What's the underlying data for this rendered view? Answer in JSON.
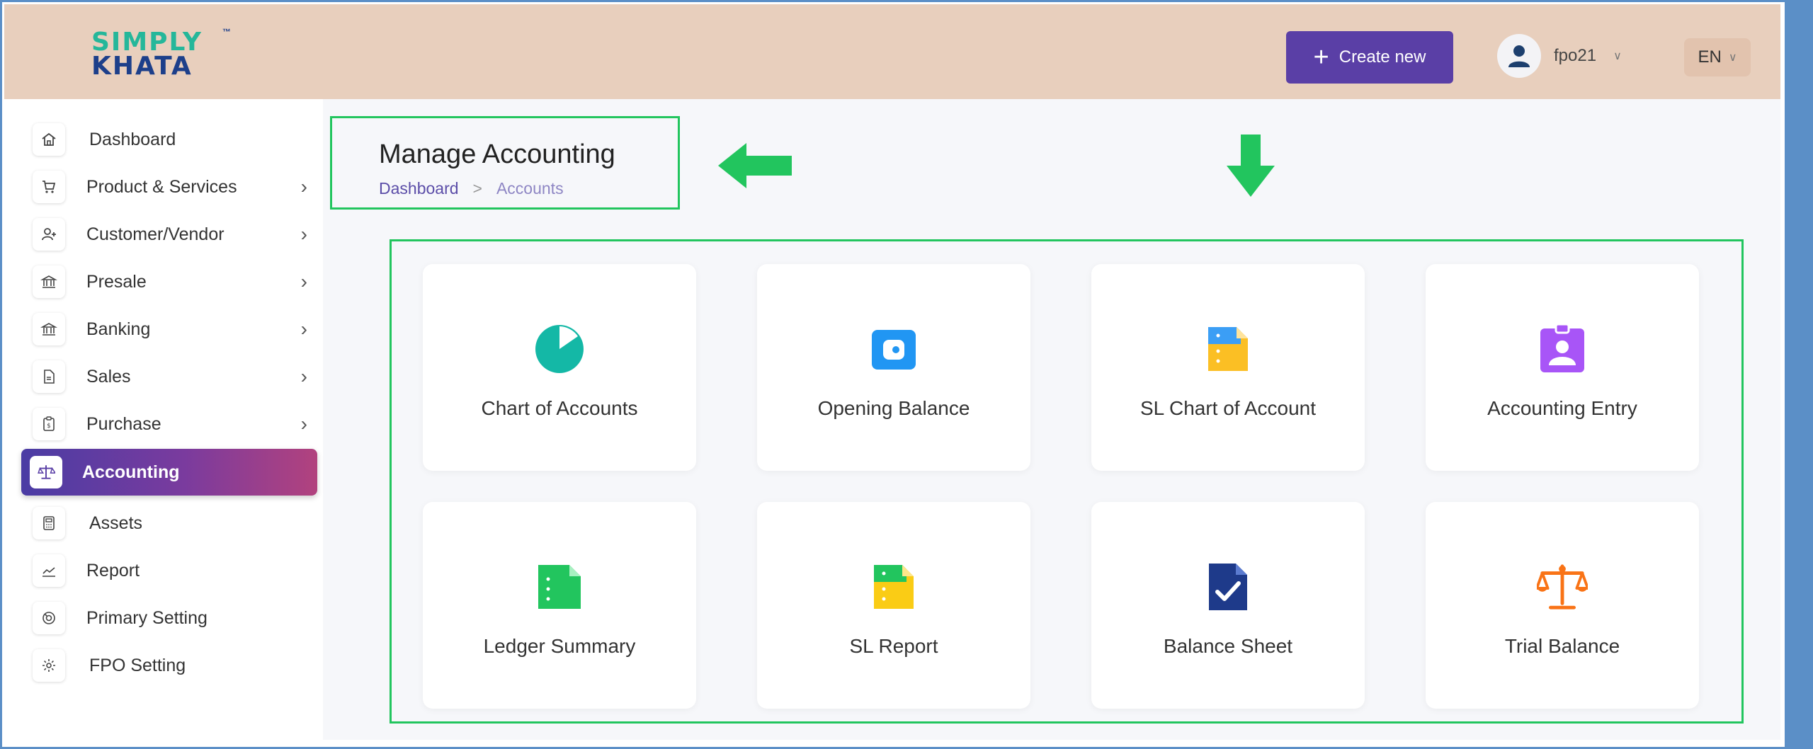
{
  "brand": {
    "line1": "SIMPLY",
    "line2": "KHATA",
    "tm": "™"
  },
  "header": {
    "create_label": "Create new",
    "user_name": "fpo21",
    "lang": "EN"
  },
  "sidebar": {
    "items": [
      {
        "label": "Dashboard",
        "icon": "home-icon"
      },
      {
        "label": "Product & Services",
        "icon": "cart-icon"
      },
      {
        "label": "Customer/Vendor",
        "icon": "user-add-icon"
      },
      {
        "label": "Presale",
        "icon": "bank-icon"
      },
      {
        "label": "Banking",
        "icon": "bank-icon"
      },
      {
        "label": "Sales",
        "icon": "document-icon"
      },
      {
        "label": "Purchase",
        "icon": "clipboard-dollar-icon"
      },
      {
        "label": "Accounting",
        "icon": "scale-icon"
      },
      {
        "label": "Assets",
        "icon": "calculator-icon"
      },
      {
        "label": "Report",
        "icon": "chart-line-icon"
      },
      {
        "label": "Primary Setting",
        "icon": "gear-icon"
      },
      {
        "label": "FPO Setting",
        "icon": "gear-icon"
      }
    ]
  },
  "page": {
    "title": "Manage Accounting",
    "breadcrumb": {
      "root": "Dashboard",
      "separator": ">",
      "current": "Accounts"
    }
  },
  "cards": [
    {
      "label": "Chart of Accounts",
      "icon": "pie-chart-icon",
      "color": "#14b8a6"
    },
    {
      "label": "Opening Balance",
      "icon": "wallet-icon",
      "color": "#2196f3"
    },
    {
      "label": "SL Chart of Account",
      "icon": "spreadsheet-icon",
      "color": "#fbbf24"
    },
    {
      "label": "Accounting Entry",
      "icon": "id-badge-icon",
      "color": "#a855f7"
    },
    {
      "label": "Ledger Summary",
      "icon": "sheet-icon",
      "color": "#22c55e"
    },
    {
      "label": "SL Report",
      "icon": "report-icon",
      "color": "#facc15"
    },
    {
      "label": "Balance Sheet",
      "icon": "document-check-icon",
      "color": "#1e3a8a"
    },
    {
      "label": "Trial Balance",
      "icon": "scale-icon",
      "color": "#f97316"
    }
  ],
  "colors": {
    "accent": "#5a3fa6",
    "header_bg": "#e8cfbd",
    "annotation": "#22c55e"
  }
}
